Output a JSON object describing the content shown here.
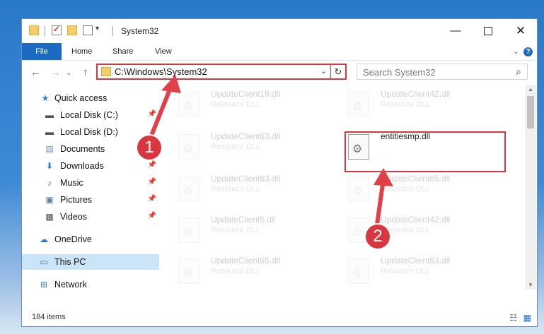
{
  "window": {
    "title": "System32"
  },
  "ribbon": {
    "tabs": [
      "File",
      "Home",
      "Share",
      "View"
    ]
  },
  "address": {
    "path": "C:\\Windows\\System32"
  },
  "search": {
    "placeholder": "Search System32"
  },
  "nav": {
    "items": [
      {
        "label": "Quick access",
        "icon": "star-icon"
      },
      {
        "label": "Local Disk (C:)",
        "icon": "drive-icon"
      },
      {
        "label": "Local Disk (D:)",
        "icon": "drive-icon"
      },
      {
        "label": "Documents",
        "icon": "documents-icon"
      },
      {
        "label": "Downloads",
        "icon": "download-icon"
      },
      {
        "label": "Music",
        "icon": "music-icon"
      },
      {
        "label": "Pictures",
        "icon": "pictures-icon"
      },
      {
        "label": "Videos",
        "icon": "videos-icon"
      },
      {
        "label": "OneDrive",
        "icon": "cloud-icon"
      },
      {
        "label": "This PC",
        "icon": "computer-icon"
      },
      {
        "label": "Network",
        "icon": "network-icon"
      }
    ]
  },
  "files": [
    {
      "name": "UpdateClient19.dll",
      "type": "Resource DLL"
    },
    {
      "name": "UpdateClient42.dll",
      "type": "Resource DLL"
    },
    {
      "name": "UpdateClient63.dll",
      "type": "Resource DLL"
    },
    {
      "name": "entitiesmp.dll",
      "type": ""
    },
    {
      "name": "UpdateClient63.dll",
      "type": "Resource DLL"
    },
    {
      "name": "UpdateClient65.dll",
      "type": "Resource DLL"
    },
    {
      "name": "UpdateClient5.dll",
      "type": "Resource DLL"
    },
    {
      "name": "UpdateClient42.dll",
      "type": "Resource DLL"
    },
    {
      "name": "UpdateClient65.dll",
      "type": "Resource DLL"
    },
    {
      "name": "UpdateClient63.dll",
      "type": "Resource DLL"
    }
  ],
  "status": {
    "count": "184 items"
  },
  "callouts": [
    "1",
    "2"
  ],
  "colors": {
    "accent": "#1c6bc2",
    "highlight": "#d9373f"
  }
}
